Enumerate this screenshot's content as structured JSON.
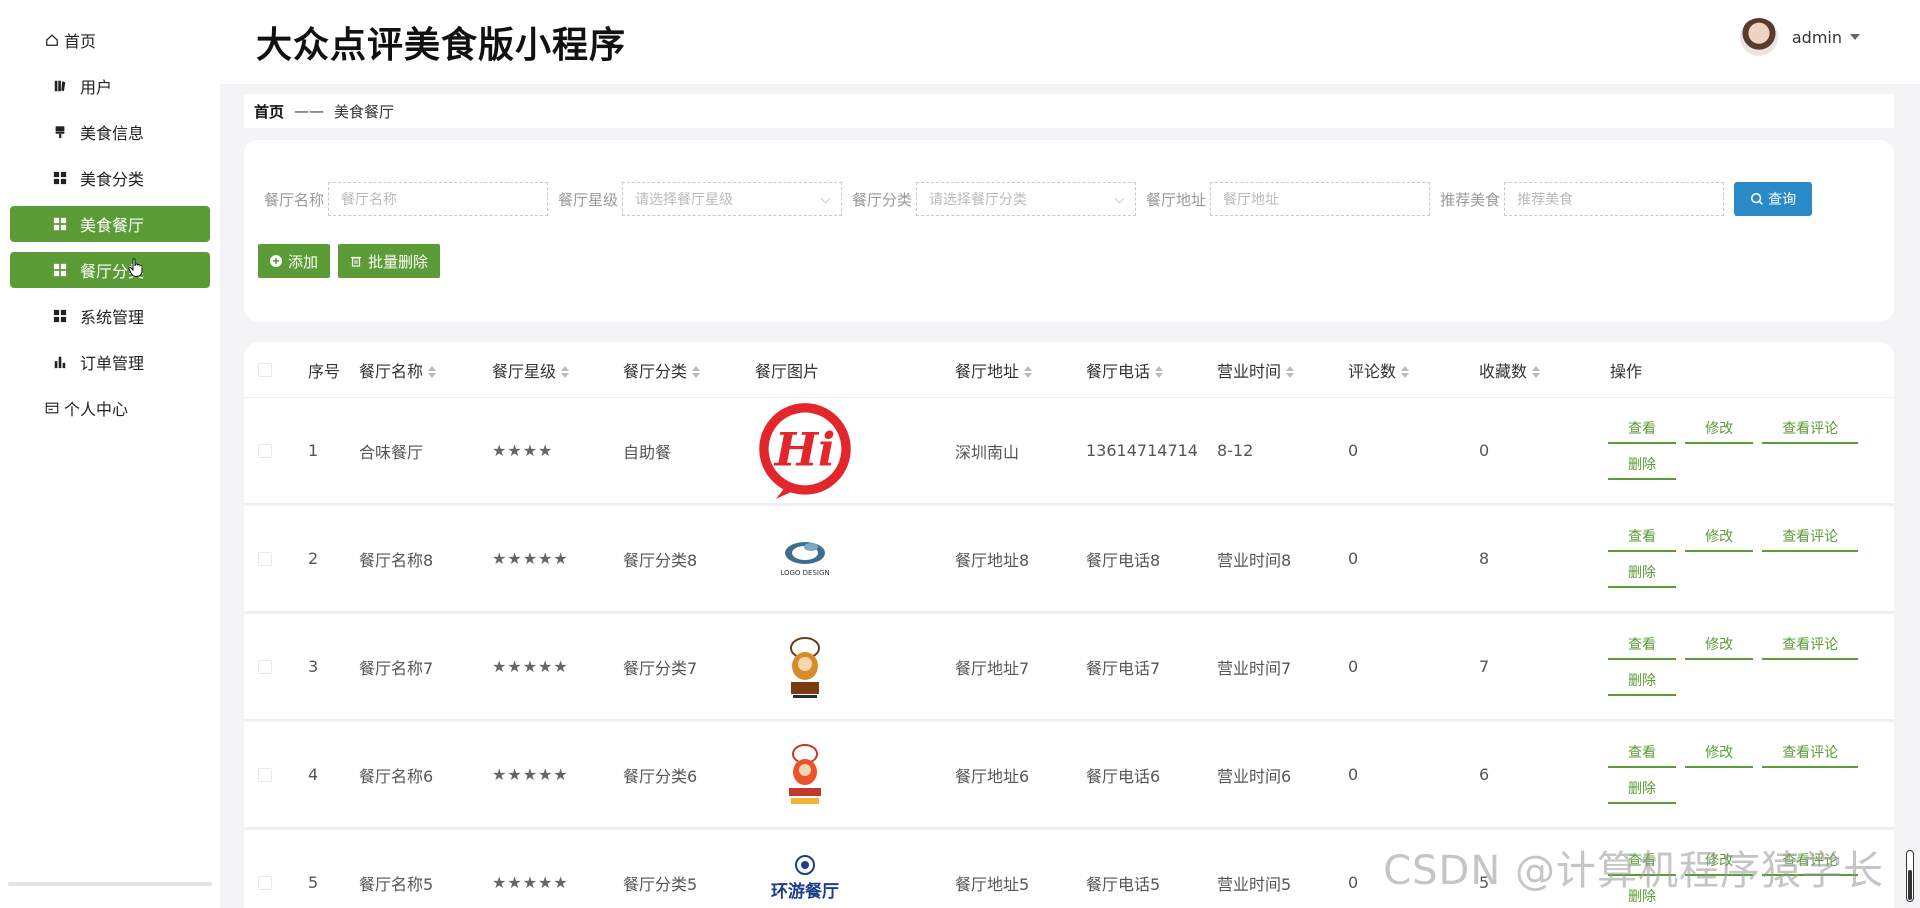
{
  "app": {
    "title": "大众点评美食版小程序"
  },
  "user": {
    "name": "admin"
  },
  "sidebar": {
    "items": [
      {
        "label": "首页",
        "icon": "home-icon",
        "level": "top"
      },
      {
        "label": "用户",
        "icon": "book-icon",
        "level": "sub"
      },
      {
        "label": "美食信息",
        "icon": "brush-icon",
        "level": "sub"
      },
      {
        "label": "美食分类",
        "icon": "grid-icon",
        "level": "sub"
      },
      {
        "label": "美食餐厅",
        "icon": "grid-icon",
        "level": "sub",
        "active": true
      },
      {
        "label": "餐厅分类",
        "icon": "grid-icon",
        "level": "sub",
        "active": true
      },
      {
        "label": "系统管理",
        "icon": "grid-icon",
        "level": "sub"
      },
      {
        "label": "订单管理",
        "icon": "bar-chart-icon",
        "level": "sub"
      },
      {
        "label": "个人中心",
        "icon": "card-icon",
        "level": "top"
      }
    ]
  },
  "breadcrumb": {
    "home": "首页",
    "separator": "——",
    "current": "美食餐厅"
  },
  "search": {
    "fields": [
      {
        "label": "餐厅名称",
        "placeholder": "餐厅名称",
        "type": "input"
      },
      {
        "label": "餐厅星级",
        "placeholder": "请选择餐厅星级",
        "type": "select"
      },
      {
        "label": "餐厅分类",
        "placeholder": "请选择餐厅分类",
        "type": "select"
      },
      {
        "label": "餐厅地址",
        "placeholder": "餐厅地址",
        "type": "input"
      },
      {
        "label": "推荐美食",
        "placeholder": "推荐美食",
        "type": "input"
      }
    ],
    "query_label": "查询",
    "add_label": "添加",
    "batch_delete_label": "批量删除"
  },
  "table": {
    "columns": [
      "序号",
      "餐厅名称",
      "餐厅星级",
      "餐厅分类",
      "餐厅图片",
      "餐厅地址",
      "餐厅电话",
      "营业时间",
      "评论数",
      "收藏数",
      "操作"
    ],
    "rows": [
      {
        "index": "1",
        "name": "合味餐厅",
        "stars": "★★★★",
        "category": "自助餐",
        "image": "hi-logo",
        "address": "深圳南山",
        "phone": "13614714714",
        "hours": "8-12",
        "comments": "0",
        "favorites": "0"
      },
      {
        "index": "2",
        "name": "餐厅名称8",
        "stars": "★★★★★",
        "category": "餐厅分类8",
        "image": "logo-design",
        "address": "餐厅地址8",
        "phone": "餐厅电话8",
        "hours": "营业时间8",
        "comments": "0",
        "favorites": "8"
      },
      {
        "index": "3",
        "name": "餐厅名称7",
        "stars": "★★★★★",
        "category": "餐厅分类7",
        "image": "chef-mascot",
        "address": "餐厅地址7",
        "phone": "餐厅电话7",
        "hours": "营业时间7",
        "comments": "0",
        "favorites": "7"
      },
      {
        "index": "4",
        "name": "餐厅名称6",
        "stars": "★★★★★",
        "category": "餐厅分类6",
        "image": "chef-mascot-2",
        "address": "餐厅地址6",
        "phone": "餐厅电话6",
        "hours": "营业时间6",
        "comments": "0",
        "favorites": "6"
      },
      {
        "index": "5",
        "name": "餐厅名称5",
        "stars": "★★★★★",
        "category": "餐厅分类5",
        "image": "huanyou-logo",
        "address": "餐厅地址5",
        "phone": "餐厅电话5",
        "hours": "营业时间5",
        "comments": "0",
        "favorites": "5"
      }
    ],
    "row_actions": {
      "view": "查看",
      "edit": "修改",
      "view_comments": "查看评论",
      "delete": "删除"
    },
    "logo_texts": {
      "logo_design": "LOGO DESIGN",
      "huanyou": "环游餐厅"
    }
  },
  "watermark": "CSDN @计算机程序猿学长",
  "colors": {
    "accent": "#5c9c36",
    "query_button": "#2a8ac9",
    "logo_red": "#e3262b"
  }
}
